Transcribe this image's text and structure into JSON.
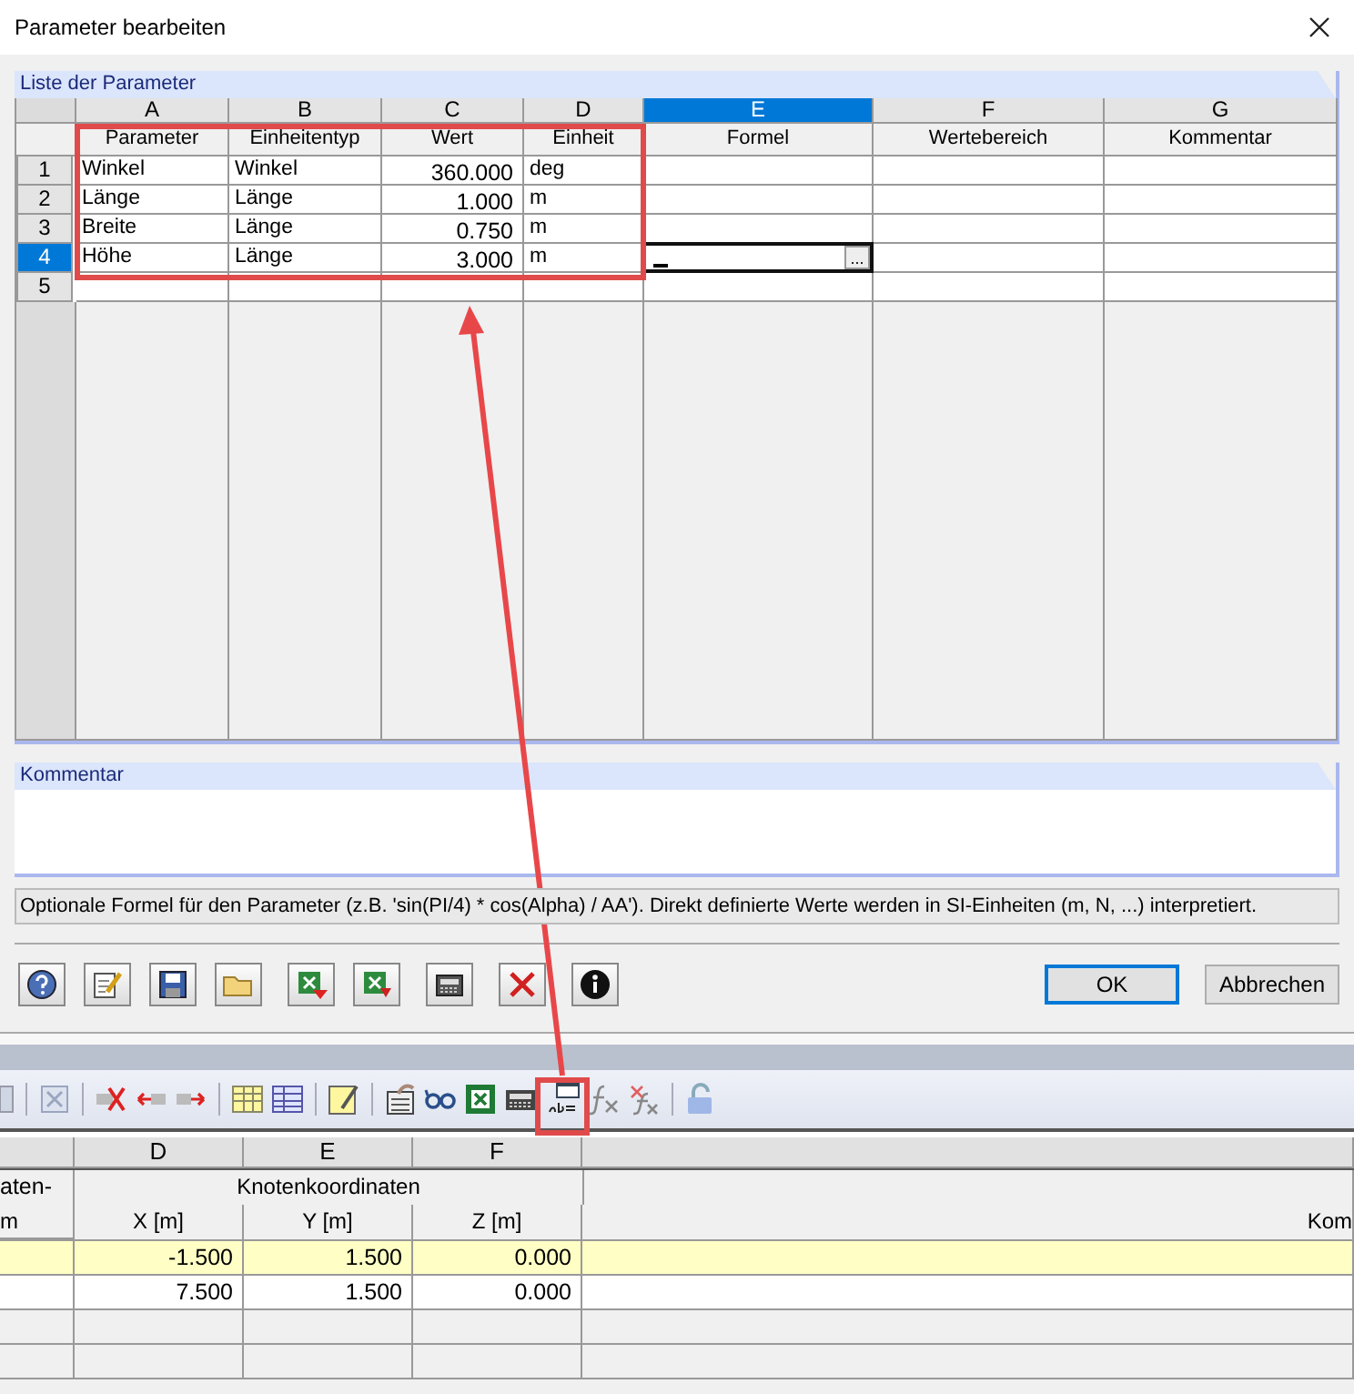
{
  "dialog": {
    "title": "Parameter bearbeiten"
  },
  "parameter_list": {
    "title": "Liste der Parameter",
    "columns": [
      {
        "letter": "A",
        "heading": "Parameter",
        "kind": "text",
        "selected": false
      },
      {
        "letter": "B",
        "heading": "Einheitentyp",
        "kind": "text",
        "selected": false
      },
      {
        "letter": "C",
        "heading": "Wert",
        "kind": "number",
        "selected": false
      },
      {
        "letter": "D",
        "heading": "Einheit",
        "kind": "text",
        "selected": false
      },
      {
        "letter": "E",
        "heading": "Formel",
        "kind": "text",
        "selected": true
      },
      {
        "letter": "F",
        "heading": "Wertebereich",
        "kind": "text",
        "selected": false
      },
      {
        "letter": "G",
        "heading": "Kommentar",
        "kind": "text",
        "selected": false
      }
    ],
    "rows": [
      {
        "number": "1",
        "selected": false,
        "editing": false,
        "cells": [
          "Winkel",
          "Winkel",
          "360.000",
          "deg"
        ]
      },
      {
        "number": "2",
        "selected": false,
        "editing": false,
        "cells": [
          "Länge",
          "Länge",
          "1.000",
          "m"
        ]
      },
      {
        "number": "3",
        "selected": false,
        "editing": false,
        "cells": [
          "Breite",
          "Länge",
          "0.750",
          "m"
        ]
      },
      {
        "number": "4",
        "selected": true,
        "editing": true,
        "cells": [
          "Höhe",
          "Länge",
          "3.000",
          "m"
        ]
      },
      {
        "number": "5",
        "selected": false,
        "editing": false
      }
    ],
    "editor_button": "..."
  },
  "comment": {
    "title": "Kommentar"
  },
  "hint": "Optionale Formel für den Parameter (z.B. 'sin(PI/4) * cos(Alpha) / AA'). Direkt definierte Werte werden in SI-Einheiten (m, N, ...) interpretiert.",
  "buttons": [
    {
      "label": "OK",
      "default": true
    },
    {
      "label": "Abbrechen",
      "default": false
    }
  ],
  "node_table": {
    "left_column": {
      "heading": "aten-",
      "unit": "m"
    },
    "group_heading": "Knotenkoordinaten",
    "columns": [
      {
        "letter": "D",
        "heading": "X [m]"
      },
      {
        "letter": "E",
        "heading": "Y [m]"
      },
      {
        "letter": "F",
        "heading": "Z [m]"
      }
    ],
    "last_column": {
      "heading": "Kom"
    },
    "rows": [
      {
        "selected": true,
        "values": [
          "-1.500",
          "1.500",
          "0.000"
        ]
      },
      {
        "selected": false,
        "values": [
          "7.500",
          "1.500",
          "0.000"
        ]
      },
      {
        "selected": false
      },
      {
        "selected": false
      }
    ]
  }
}
